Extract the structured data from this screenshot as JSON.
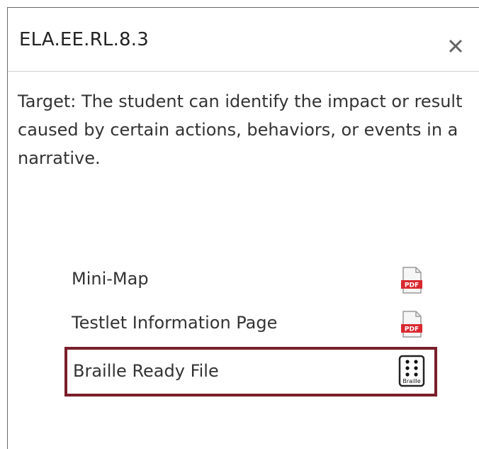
{
  "panel": {
    "title": "ELA.EE.RL.8.3",
    "close_icon": "close-icon",
    "target_text": "Target: The student can identify the impact or result caused by certain actions, behaviors, or events in a narrative."
  },
  "resources": [
    {
      "label": "Mini-Map",
      "icon": "pdf-icon",
      "icon_text": "PDF"
    },
    {
      "label": "Testlet Information Page",
      "icon": "pdf-icon",
      "icon_text": "PDF"
    },
    {
      "label": "Braille Ready File",
      "icon": "braille-icon",
      "icon_text": "Braille"
    }
  ],
  "colors": {
    "highlight_border": "#7a1f2b",
    "pdf_red": "#d9282f"
  }
}
